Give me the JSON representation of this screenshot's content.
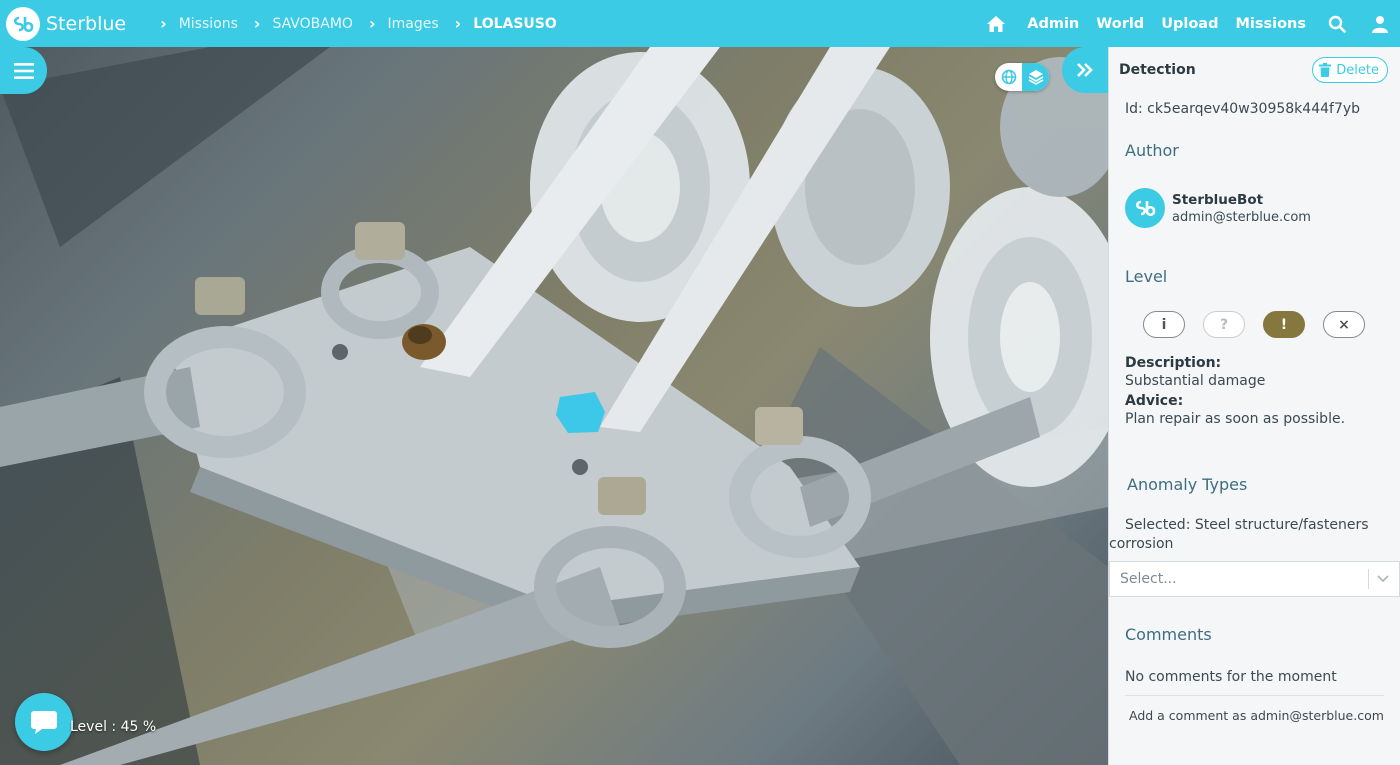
{
  "app": {
    "brand": "Sterblue",
    "breadcrumbs": [
      "Missions",
      "SAVOBAMO",
      "Images",
      "LOLASUSO"
    ],
    "nav": [
      "Admin",
      "World",
      "Upload",
      "Missions"
    ],
    "accent_color": "#3ccbe4"
  },
  "viewer": {
    "level_readout": "Level : 45 %",
    "icons": [
      "menu-icon",
      "globe-icon",
      "layers-icon",
      "double-chevron-right-icon",
      "chat-icon"
    ]
  },
  "panel": {
    "title": "Detection",
    "delete_label": "Delete",
    "id_line": "Id: ck5earqev40w30958k444f7yb",
    "author_heading": "Author",
    "author_name": "SterblueBot",
    "author_email": "admin@sterblue.com",
    "level_heading": "Level",
    "level_buttons": [
      "i",
      "?",
      "!",
      "×"
    ],
    "active_level": "!",
    "description_label": "Description:",
    "description_value": "Substantial damage",
    "advice_label": "Advice:",
    "advice_value": "Plan repair as soon as possible.",
    "anomaly_heading": "Anomaly Types",
    "anomaly_selected_line1": "Selected: Steel structure/fasteners",
    "anomaly_selected_line2": "corrosion",
    "select_placeholder": "Select...",
    "comments_heading": "Comments",
    "comments_empty": "No comments for the moment",
    "comment_add": "Add a comment as admin@sterblue.com"
  }
}
